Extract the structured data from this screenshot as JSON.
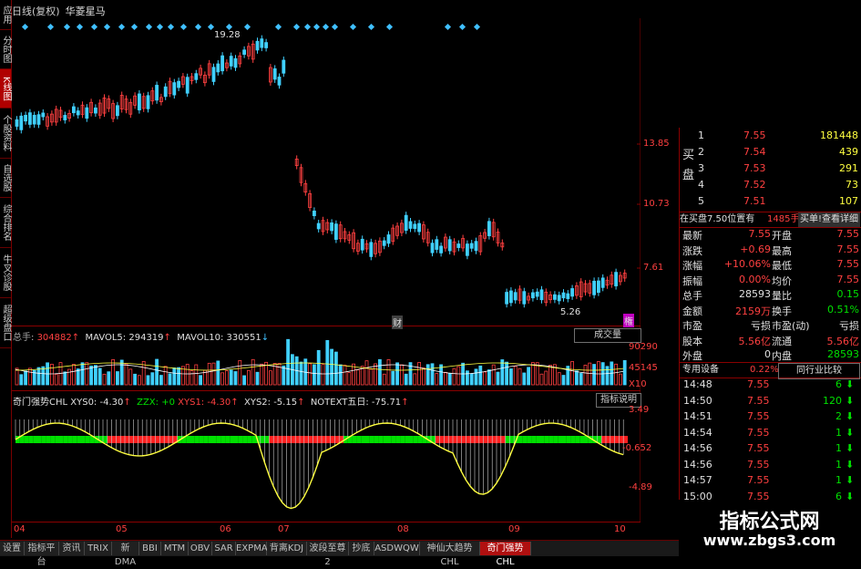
{
  "left_tabs": [
    "应用",
    "分时图",
    "K线图",
    "个股资料",
    "自选股",
    "综合排名",
    "牛叉诊股",
    "超级盘口"
  ],
  "title": {
    "period": "日线(复权)",
    "stock": "华菱星马"
  },
  "price_axis": [
    "13.85",
    "10.73",
    "7.61"
  ],
  "price_marks": {
    "high": "19.28",
    "low": "5.26",
    "fin": "财",
    "hui": "権"
  },
  "volume": {
    "label": "总手",
    "value": "304882",
    "ma5_label": "MAVOL5:",
    "ma5": "294319",
    "ma10_label": "MAVOL10:",
    "ma10": "330551",
    "button": "成交量",
    "axis": [
      "90290",
      "45145",
      "X10"
    ]
  },
  "indicator": {
    "name": "奇门强势CHL",
    "xys0": "XYS0: -4.30",
    "zzx": "ZZX: +0",
    "xys1": "XYS1: -4.30",
    "xys2": "XYS2: -5.15",
    "notext": "NOTEXT五日: -75.71",
    "button": "指标说明",
    "axis": [
      "3.49",
      "-0.652",
      "-4.89"
    ]
  },
  "x_axis": [
    "04",
    "05",
    "06",
    "07",
    "08",
    "09",
    "10"
  ],
  "order_book": {
    "side_buy": "买盘",
    "rows": [
      {
        "n": "1",
        "p": "7.55",
        "v": "181448"
      },
      {
        "n": "2",
        "p": "7.54",
        "v": "439"
      },
      {
        "n": "3",
        "p": "7.53",
        "v": "291"
      },
      {
        "n": "4",
        "p": "7.52",
        "v": "73"
      },
      {
        "n": "5",
        "p": "7.51",
        "v": "107"
      }
    ],
    "status": "在买盘7.50位置有",
    "status_num": "1485手",
    "status_btn": "买单!查看详细"
  },
  "quote": [
    {
      "l1": "最新",
      "v1": "7.55",
      "l2": "开盘",
      "v2": "7.55"
    },
    {
      "l1": "涨跌",
      "v1": "+0.69",
      "l2": "最高",
      "v2": "7.55"
    },
    {
      "l1": "涨幅",
      "v1": "+10.06%",
      "l2": "最低",
      "v2": "7.55"
    },
    {
      "l1": "振幅",
      "v1": "0.00%",
      "l2": "均价",
      "v2": "7.55"
    },
    {
      "l1": "总手",
      "v1": "28593",
      "l2": "量比",
      "v2": "0.15"
    },
    {
      "l1": "金额",
      "v1": "2159万",
      "l2": "换手",
      "v2": "0.51%"
    },
    {
      "l1": "市盈",
      "v1": "亏损",
      "l2": "市盈(动)",
      "v2": "亏损"
    },
    {
      "l1": "股本",
      "v1": "5.56亿",
      "l2": "流通",
      "v2": "5.56亿"
    },
    {
      "l1": "外盘",
      "v1": "0",
      "l2": "内盘",
      "v2": "28593"
    }
  ],
  "sector": {
    "name": "专用设备",
    "pct": "0.22%",
    "btn": "同行业比较"
  },
  "ticks": [
    {
      "t": "14:48",
      "p": "7.55",
      "v": "6"
    },
    {
      "t": "14:50",
      "p": "7.55",
      "v": "120"
    },
    {
      "t": "14:51",
      "p": "7.55",
      "v": "2"
    },
    {
      "t": "14:54",
      "p": "7.55",
      "v": "1"
    },
    {
      "t": "14:56",
      "p": "7.55",
      "v": "1"
    },
    {
      "t": "14:56",
      "p": "7.55",
      "v": "1"
    },
    {
      "t": "14:57",
      "p": "7.55",
      "v": "1"
    },
    {
      "t": "15:00",
      "p": "7.55",
      "v": "6"
    }
  ],
  "bottom_tabs": [
    "设置",
    "指标平台",
    "资讯",
    "TRIX",
    "新DMA",
    "BBI",
    "MTM",
    "OBV",
    "SAR",
    "EXPMA",
    "背离KDJ",
    "波段至尊2",
    "抄底",
    "ASDWQW",
    "神仙大趋势CHL",
    "奇门强势CHL"
  ],
  "watermark": {
    "title": "指标公式网",
    "url": "www.zbgs3.com"
  }
}
